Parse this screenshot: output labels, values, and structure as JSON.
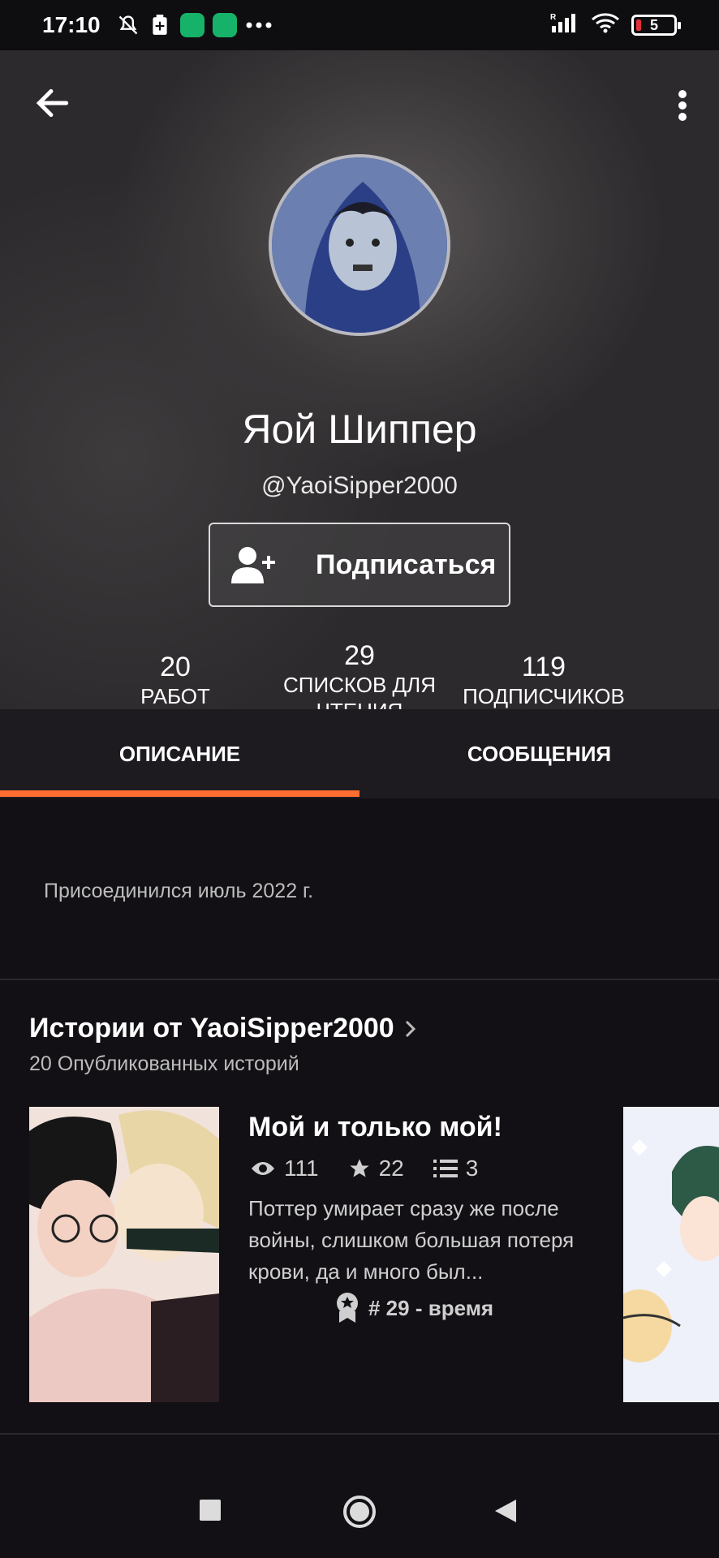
{
  "status_bar": {
    "time": "17:10",
    "battery": "5",
    "icons": [
      "bell-off-icon",
      "clipboard-icon",
      "app-icon",
      "app-icon",
      "more-dots-icon",
      "signal-icon",
      "wifi-icon",
      "battery-icon"
    ]
  },
  "profile": {
    "display_name": "Яой Шиппер",
    "username": "@YaoiSipper2000",
    "follow_label": "Подписаться"
  },
  "stats": [
    {
      "value": "20",
      "label": "РАБОТ"
    },
    {
      "value": "29",
      "label": "СПИСКОВ ДЛЯ ЧТЕНИЯ"
    },
    {
      "value": "119",
      "label": "ПОДПИСЧИКОВ"
    }
  ],
  "tabs": [
    {
      "label": "ОПИСАНИЕ",
      "active": true
    },
    {
      "label": "СООБЩЕНИЯ",
      "active": false
    }
  ],
  "about": {
    "joined": "Присоединился июль 2022 г."
  },
  "stories_section": {
    "title": "Истории от YaoiSipper2000",
    "subtitle": "20 Опубликованных историй"
  },
  "story": {
    "title": "Мой и только мой!",
    "reads": "111",
    "votes": "22",
    "parts": "3",
    "description": "Поттер умирает сразу же после войны, слишком большая потеря крови, да и много был...",
    "rank": "# 29 - время"
  },
  "colors": {
    "accent": "#ff6d31",
    "background": "#121014",
    "tab_bar": "#1d1b1f"
  }
}
